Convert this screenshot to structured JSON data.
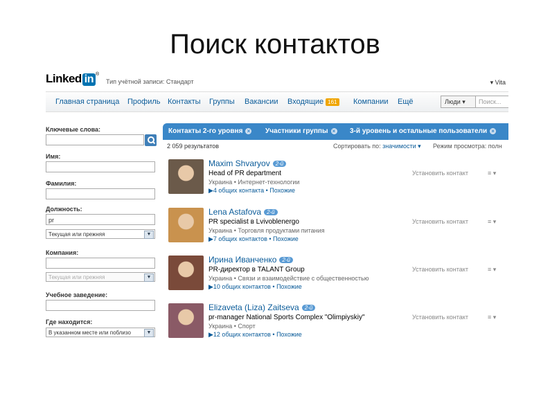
{
  "slide_title": "Поиск контактов",
  "top": {
    "logo_text": "Linked",
    "logo_in": "in",
    "logo_reg": "®",
    "account_type": "Тип учётной записи: Стандарт",
    "user_menu": "▾ Vita"
  },
  "nav": {
    "items": [
      "Главная страница",
      "Профиль",
      "Контакты",
      "Группы",
      "Вакансии",
      "Входящие",
      "Компании",
      "Ещё"
    ],
    "inbox_badge": "161",
    "people_select": "Люди ▾",
    "search_placeholder": "Поиск..."
  },
  "filters": {
    "keywords_label": "Ключевые слова:",
    "keywords_value": "",
    "first_name_label": "Имя:",
    "first_name_value": "",
    "last_name_label": "Фамилия:",
    "last_name_value": "",
    "title_label": "Должность:",
    "title_value": "pr",
    "title_scope": "Текущая или прежняя",
    "company_label": "Компания:",
    "company_value": "",
    "company_scope": "Текущая или прежняя",
    "school_label": "Учебное заведение:",
    "school_value": "",
    "location_label": "Где находится:",
    "location_value": "В указанном месте или поблизо"
  },
  "results": {
    "tabs": [
      "Контакты 2-го уровня",
      "Участники группы",
      "3-й уровень и остальные пользователи"
    ],
    "count": "2 059 результатов",
    "sort_label": "Сортировать по:",
    "sort_value": "значимости ▾",
    "view_label": "Режим просмотра:",
    "view_value": "полн",
    "connect_label": "Установить контакт",
    "more_label": "≡ ▾",
    "people": [
      {
        "name": "Maxim Shvaryov",
        "degree": "2-й",
        "headline": "Head of PR department",
        "location": "Украина • Интернет-технологии",
        "shared": "▶4 общих контакта • Похожие",
        "avatar_color": "#6b5a4a"
      },
      {
        "name": "Lena Astafova",
        "degree": "2-й",
        "headline": "PR specialist в Lvivoblenergo",
        "location": "Украина • Торговля продуктами питания",
        "shared": "▶7 общих контактов • Похожие",
        "avatar_color": "#c9924e"
      },
      {
        "name": "Ирина Иванченко",
        "degree": "2-й",
        "headline": "PR-директор в TALANT Group",
        "location": "Украина • Связи и взаимодействие с общественностью",
        "shared": "▶10 общих контактов • Похожие",
        "avatar_color": "#7a4a3a"
      },
      {
        "name": "Elizaveta (Liza) Zaitseva",
        "degree": "2-й",
        "headline": "pr-manager National Sports Complex \"Olimpiyskiy\"",
        "location": "Украина • Спорт",
        "shared": "▶12 общих контактов • Похожие",
        "avatar_color": "#8a5a66"
      }
    ]
  }
}
